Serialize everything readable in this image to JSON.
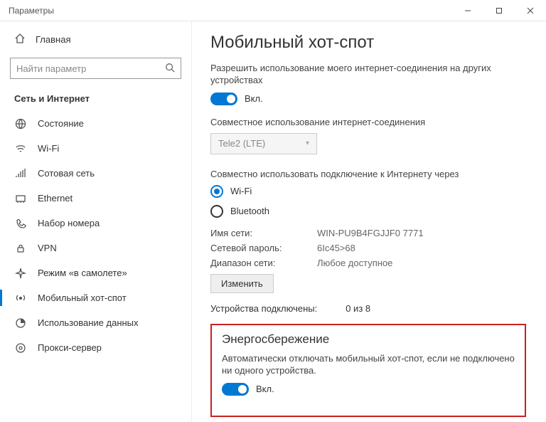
{
  "window": {
    "title": "Параметры"
  },
  "sidebar": {
    "home": "Главная",
    "search_placeholder": "Найти параметр",
    "category": "Сеть и Интернет",
    "items": [
      {
        "label": "Состояние"
      },
      {
        "label": "Wi-Fi"
      },
      {
        "label": "Сотовая сеть"
      },
      {
        "label": "Ethernet"
      },
      {
        "label": "Набор номера"
      },
      {
        "label": "VPN"
      },
      {
        "label": "Режим «в самолете»"
      },
      {
        "label": "Мобильный хот-спот"
      },
      {
        "label": "Использование данных"
      },
      {
        "label": "Прокси-сервер"
      }
    ]
  },
  "page": {
    "title": "Мобильный хот-спот",
    "share_desc": "Разрешить использование моего интернет-соединения на других устройствах",
    "toggle_on": "Вкл.",
    "share_conn_label": "Совместное использование интернет-соединения",
    "conn_dropdown": "Tele2 (LTE)",
    "share_via_label": "Совместно использовать подключение к Интернету через",
    "radio_wifi": "Wi-Fi",
    "radio_bt": "Bluetooth",
    "kv": {
      "name_k": "Имя сети:",
      "name_v": "WIN-PU9B4FGJJF0 7771",
      "pass_k": "Сетевой пароль:",
      "pass_v": "6Ic45>68",
      "band_k": "Диапазон сети:",
      "band_v": "Любое доступное"
    },
    "edit_btn": "Изменить",
    "connected_k": "Устройства подключены:",
    "connected_v": "0 из 8",
    "power": {
      "heading": "Энергосбережение",
      "desc": "Автоматически отключать мобильный хот-спот, если не подключено ни одного устройства.",
      "toggle": "Вкл."
    }
  }
}
